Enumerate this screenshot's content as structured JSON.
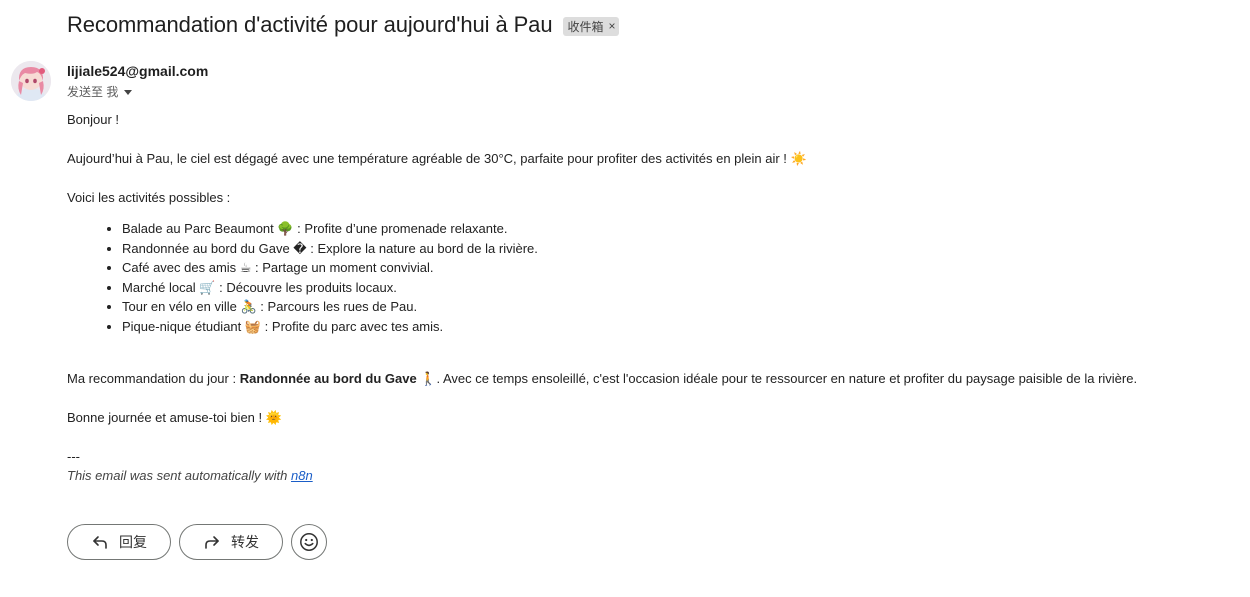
{
  "email": {
    "subject": "Recommandation d'activité pour aujourd'hui à Pau",
    "label": "收件箱",
    "label_close": "×",
    "sender": "lijiale524@gmail.com",
    "recipient_text": "发送至 我"
  },
  "body": {
    "greeting": "Bonjour !",
    "intro": "Aujourd’hui à Pau, le ciel est dégagé avec une température agréable de 30°C, parfaite pour profiter des activités en plein air ! ☀️",
    "activities_intro": "Voici les activités possibles :",
    "activities": [
      "Balade au Parc Beaumont 🌳 : Profite d’une promenade relaxante.",
      "Randonnée au bord du Gave � : Explore la nature au bord de la rivière.",
      "Café avec des amis ☕ : Partage un moment convivial.",
      "Marché local 🛒 : Découvre les produits locaux.",
      "Tour en vélo en ville 🚴 : Parcours les rues de Pau.",
      "Pique-nique étudiant 🧺 : Profite du parc avec tes amis."
    ],
    "recommendation_prefix": "Ma recommandation du jour : ",
    "recommendation_bold": "Randonnée au bord du Gave",
    "recommendation_suffix": " 🚶. Avec ce temps ensoleillé, c'est l'occasion idéale pour te ressourcer en nature et profiter du paysage paisible de la rivière.",
    "goodbye": "Bonne journée et amuse-toi bien ! 🌞",
    "separator": "---",
    "footer_prefix": "This email was sent automatically with ",
    "footer_link": "n8n"
  },
  "actions": {
    "reply_label": "回复",
    "forward_label": "转发"
  },
  "icons": {
    "avatar": "avatar-image",
    "reply": "reply-icon",
    "forward": "forward-icon",
    "emoji": "emoji-reaction-icon",
    "caret": "chevron-down-icon"
  },
  "colors": {
    "link": "#1a5dc7",
    "chip_bg": "#dddddd",
    "button_border": "#747775"
  }
}
